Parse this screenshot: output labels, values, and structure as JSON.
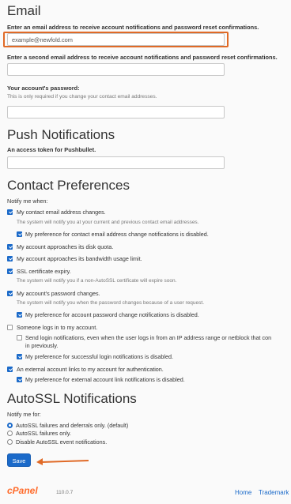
{
  "email": {
    "heading": "Email",
    "primary_label": "Enter an email address to receive account notifications and password reset confirmations.",
    "primary_value": "example@newfold.com",
    "secondary_label": "Enter a second email address to receive account notifications and password reset confirmations.",
    "secondary_value": "",
    "password_label": "Your account's password:",
    "password_help": "This is only required if you change your contact email addresses.",
    "password_value": ""
  },
  "push": {
    "heading": "Push Notifications",
    "token_label": "An access token for Pushbullet.",
    "token_value": ""
  },
  "contact": {
    "heading": "Contact Preferences",
    "notify_label": "Notify me when:",
    "items": [
      {
        "label": "My contact email address changes.",
        "checked": true,
        "help": "The system will notify you at your current and previous contact email addresses."
      },
      {
        "label": "My preference for contact email address change notifications is disabled.",
        "checked": true
      },
      {
        "label": "My account approaches its disk quota.",
        "checked": true
      },
      {
        "label": "My account approaches its bandwidth usage limit.",
        "checked": true
      },
      {
        "label": "SSL certificate expiry.",
        "checked": true,
        "help": "The system will notify you if a non-AutoSSL certificate will expire soon."
      },
      {
        "label": "My account's password changes.",
        "checked": true,
        "help": "The system will notify you when the password changes because of a user request."
      },
      {
        "label": "My preference for account password change notifications is disabled.",
        "checked": true
      },
      {
        "label": "Someone logs in to my account.",
        "checked": false
      },
      {
        "label": "Send login notifications, even when the user logs in from an IP address range or netblock that con",
        "label_line2": "in previously.",
        "checked": false
      },
      {
        "label": "My preference for successful login notifications is disabled.",
        "checked": true
      },
      {
        "label": "An external account links to my account for authentication.",
        "checked": true
      },
      {
        "label": "My preference for external account link notifications is disabled.",
        "checked": true
      }
    ]
  },
  "autossl": {
    "heading": "AutoSSL Notifications",
    "notify_label": "Notify me for:",
    "options": [
      {
        "label": "AutoSSL failures and deferrals only. (default)",
        "selected": true
      },
      {
        "label": "AutoSSL failures only.",
        "selected": false
      },
      {
        "label": "Disable AutoSSL event notifications.",
        "selected": false
      }
    ],
    "save_label": "Save"
  },
  "footer": {
    "brand": "cPanel",
    "version": "110.0.7",
    "links": [
      "Home",
      "Trademark"
    ]
  },
  "colors": {
    "accent": "#1b6ac9",
    "highlight": "#e06a27",
    "brand": "#ff6c2c"
  }
}
